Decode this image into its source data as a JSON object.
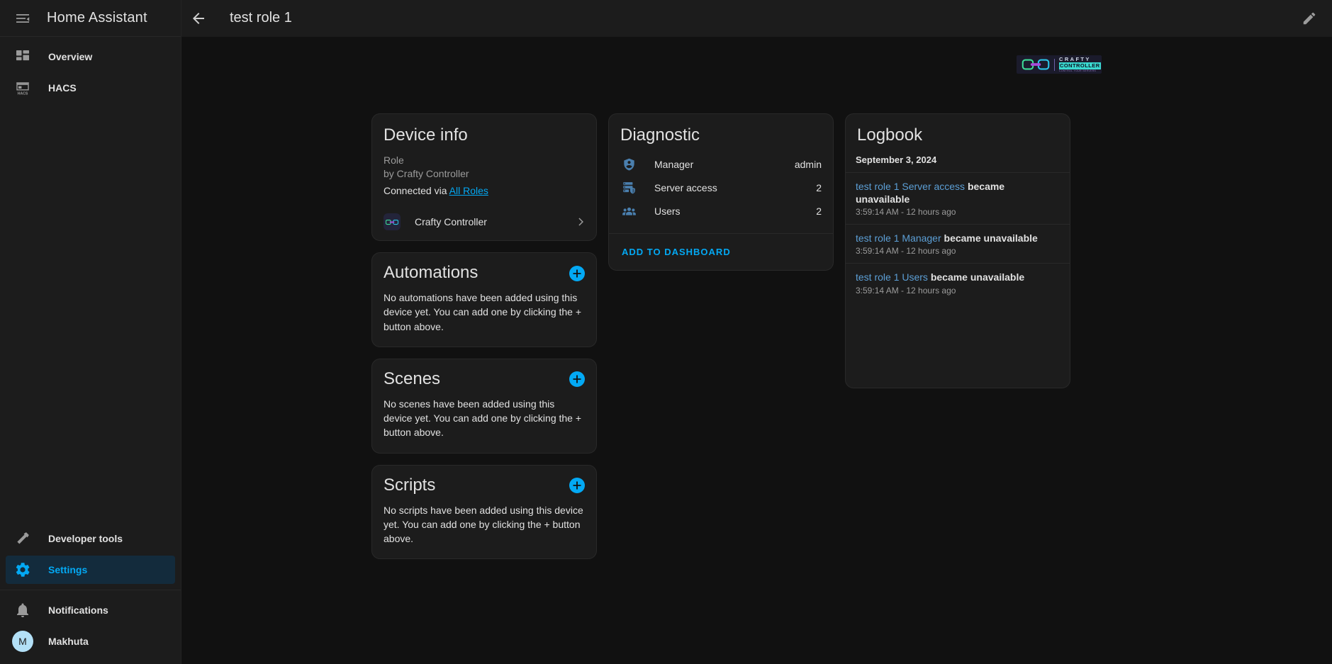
{
  "sidebar": {
    "title": "Home Assistant",
    "menu_icon": "menu-collapse-icon",
    "items": [
      {
        "label": "Overview",
        "icon": "view-dashboard-icon",
        "active": false
      },
      {
        "label": "HACS",
        "icon": "hacs-store-icon",
        "active": false
      }
    ],
    "bottom_items": [
      {
        "label": "Developer tools",
        "icon": "hammer-icon",
        "active": false
      },
      {
        "label": "Settings",
        "icon": "cog-icon",
        "active": true
      }
    ],
    "footer_items": [
      {
        "label": "Notifications",
        "icon": "bell-icon"
      },
      {
        "label": "Makhuta",
        "icon": "avatar",
        "initial": "M"
      }
    ]
  },
  "topbar": {
    "back_icon": "arrow-left-icon",
    "title": "test role 1",
    "edit_icon": "pencil-icon"
  },
  "brand": {
    "line1": "CRAFTY",
    "line2": "CONTROLLER",
    "line3": "CONTROL YOUR SERVERS"
  },
  "device_info": {
    "title": "Device info",
    "model": "Role",
    "manufacturer": "by Crafty Controller",
    "connected_prefix": "Connected via",
    "connected_link": "All Roles",
    "integration": {
      "name": "Crafty Controller",
      "icon": "crafty-controller-icon",
      "chevron": "chevron-right-icon"
    }
  },
  "diagnostic": {
    "title": "Diagnostic",
    "rows": [
      {
        "icon": "shield-account-icon",
        "name": "Manager",
        "value": "admin"
      },
      {
        "icon": "server-security-icon",
        "name": "Server access",
        "value": "2"
      },
      {
        "icon": "account-group-icon",
        "name": "Users",
        "value": "2"
      }
    ],
    "action_label": "ADD TO DASHBOARD"
  },
  "automations": {
    "title": "Automations",
    "add_icon": "plus-circle-icon",
    "empty_text": "No automations have been added using this device yet. You can add one by clicking the + button above."
  },
  "scenes": {
    "title": "Scenes",
    "add_icon": "plus-circle-icon",
    "empty_text": "No scenes have been added using this device yet. You can add one by clicking the + button above."
  },
  "scripts": {
    "title": "Scripts",
    "add_icon": "plus-circle-icon",
    "empty_text": "No scripts have been added using this device yet. You can add one by clicking the + button above."
  },
  "logbook": {
    "title": "Logbook",
    "date": "September 3, 2024",
    "entries": [
      {
        "entity": "test role 1 Server access",
        "state": "became unavailable",
        "time": "3:59:14 AM - 12 hours ago"
      },
      {
        "entity": "test role 1 Manager",
        "state": "became unavailable",
        "time": "3:59:14 AM - 12 hours ago"
      },
      {
        "entity": "test role 1 Users",
        "state": "became unavailable",
        "time": "3:59:14 AM - 12 hours ago"
      }
    ]
  },
  "colors": {
    "accent": "#03a9f4",
    "background": "#111111",
    "card": "#1c1c1c",
    "sidebar": "#1c1c1c",
    "text_primary": "#e1e1e1",
    "text_secondary": "#9b9b9b",
    "diagnostic_icon": "#4a7fae",
    "logbook_entity": "#5c9fd6",
    "avatar": "#b3e0f7"
  }
}
